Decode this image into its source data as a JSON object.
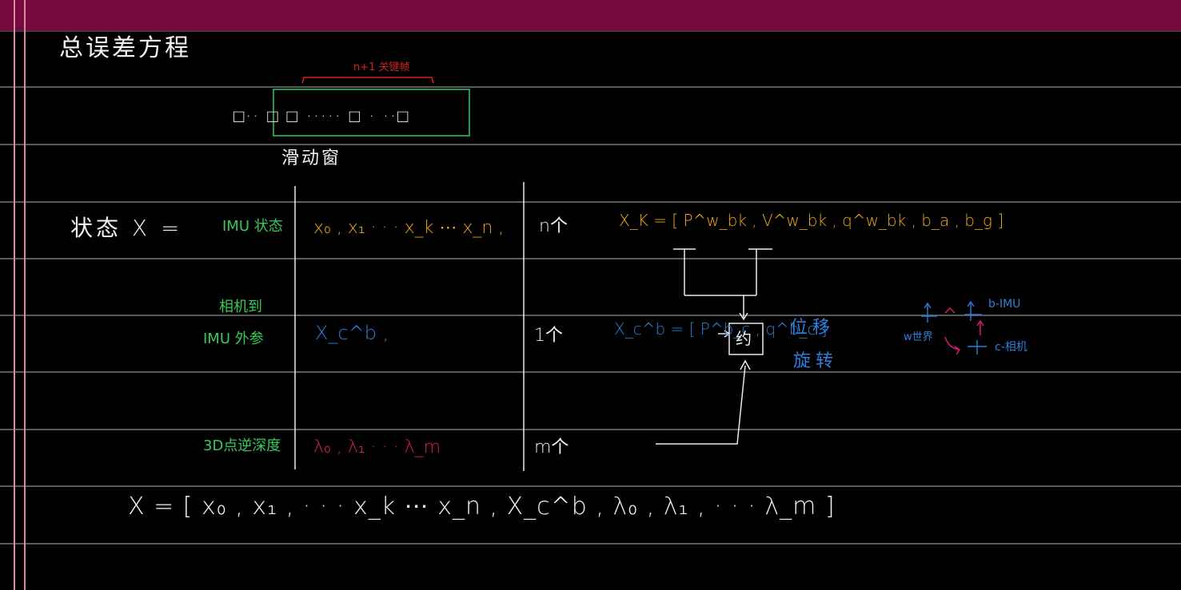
{
  "title": "总误差方程",
  "window_label": "n+1 关键帧",
  "frames_row": "□··  □ □ ····· □ ·  ··□",
  "sliding_window_label": "滑动窗",
  "state_label": "状态 X =",
  "rows": [
    {
      "label": "IMU 状态",
      "value": "x₀ , x₁ · · · x_k ⋯ x_n ,",
      "count": "n个"
    },
    {
      "label_line1": "相机到",
      "label_line2": "IMU 外参",
      "value": "X_c^b ,",
      "count": "1个"
    },
    {
      "label": "3D点逆深度",
      "value": "λ₀ , λ₁ · · · λ_m",
      "count": "m个"
    }
  ],
  "xk_definition": "X_K = [ P^w_bk , V^w_bk , q^w_bk , b_a , b_g ]",
  "xcb_definition": "X_c^b = [ P^b_c , q^b_c ]",
  "box_label": "约",
  "position_label": "位移",
  "rotation_label": "旋转",
  "frame_legend": {
    "b_imu": "b-IMU",
    "w_world": "w世界",
    "c_camera": "c-相机"
  },
  "final_equation": "X = [ x₀ , x₁ , · · · x_k ⋯ x_n ,  X_c^b ,  λ₀ , λ₁ , · · · λ_m ]",
  "colors": {
    "topbar": "#740a40",
    "orange": "#f2a81a",
    "green": "#38c95a",
    "blue": "#2f7fd9",
    "magenta": "#e6197a",
    "red": "#d42222",
    "window_box": "#2fbf5a"
  }
}
